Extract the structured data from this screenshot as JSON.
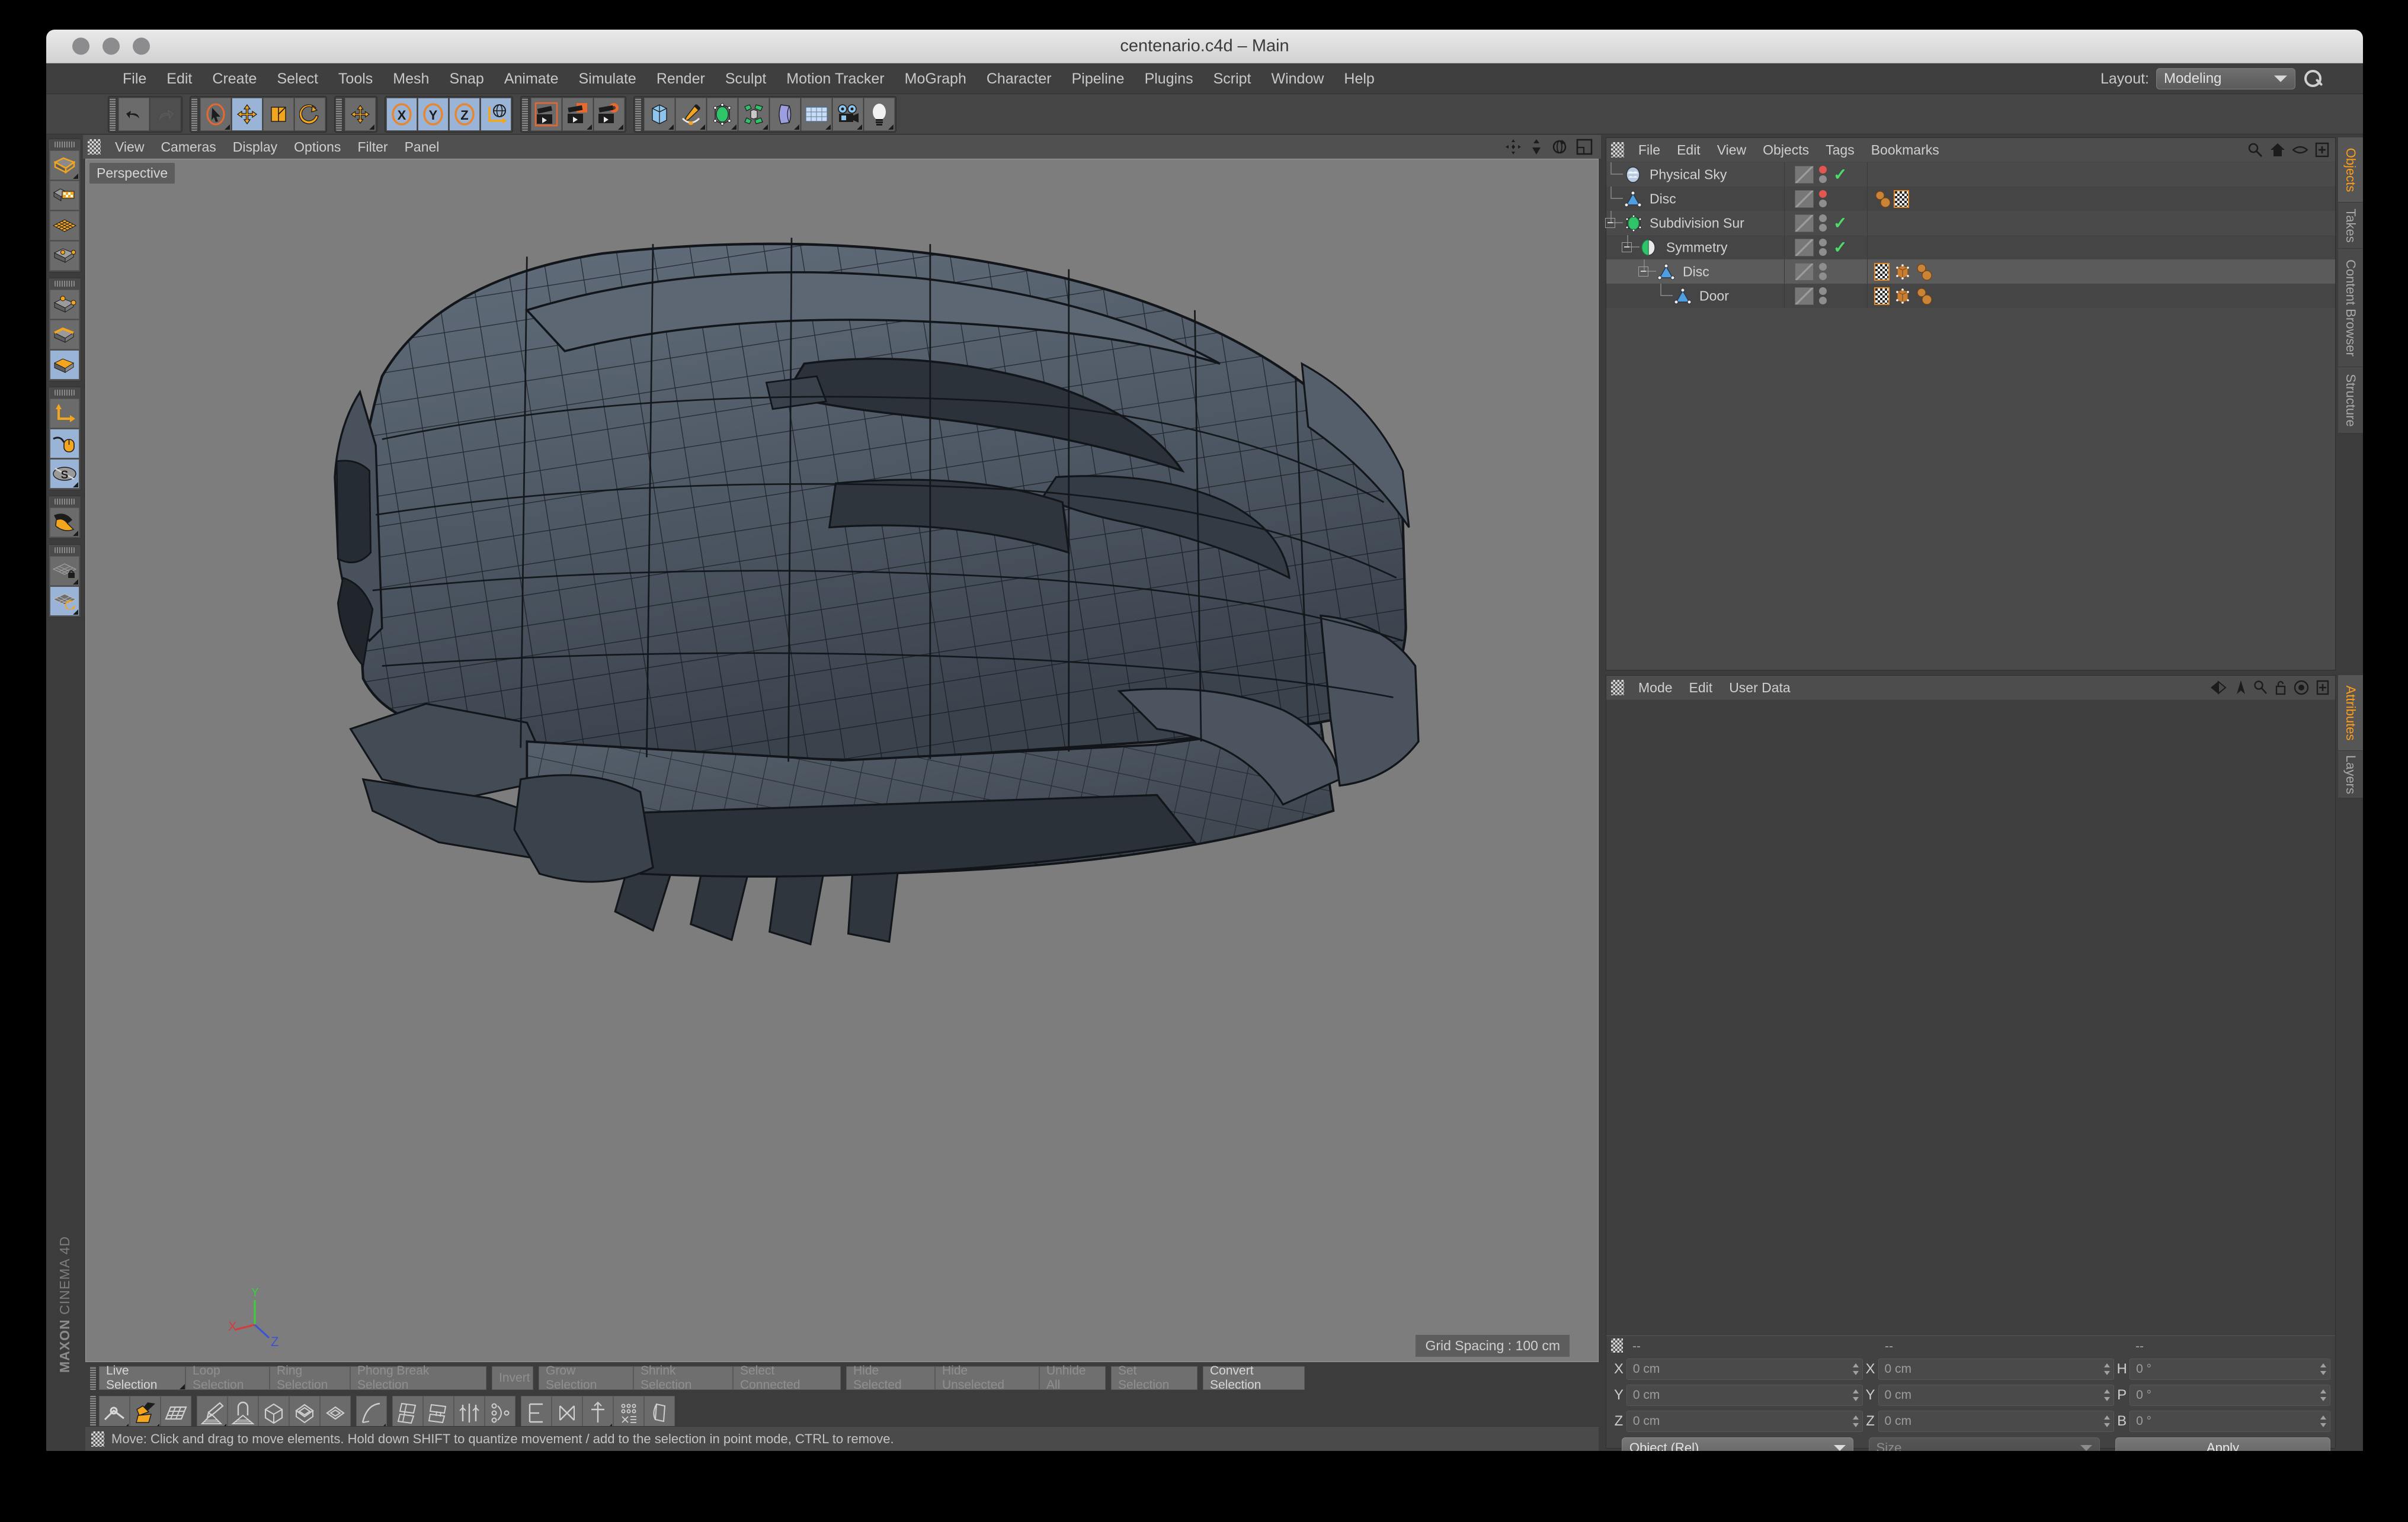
{
  "window": {
    "title": "centenario.c4d – Main",
    "traffic_lights": [
      "close",
      "minimize",
      "zoom"
    ]
  },
  "menubar": {
    "items": [
      "File",
      "Edit",
      "Create",
      "Select",
      "Tools",
      "Mesh",
      "Snap",
      "Animate",
      "Simulate",
      "Render",
      "Sculpt",
      "Motion Tracker",
      "MoGraph",
      "Character",
      "Pipeline",
      "Plugins",
      "Script",
      "Window",
      "Help"
    ],
    "layout_label": "Layout:",
    "layout_value": "Modeling",
    "search_icon": "search-icon"
  },
  "toolbar": {
    "groups": [
      {
        "name": "history",
        "buttons": [
          {
            "icon": "undo-icon",
            "state": "normal"
          },
          {
            "icon": "redo-icon",
            "state": "disabled"
          }
        ]
      },
      {
        "name": "tools",
        "buttons": [
          {
            "icon": "live-selection-icon",
            "state": "normal"
          },
          {
            "icon": "move-icon",
            "state": "active"
          },
          {
            "icon": "scale-icon",
            "state": "normal"
          },
          {
            "icon": "rotate-icon",
            "state": "normal"
          }
        ]
      },
      {
        "name": "axis",
        "buttons": [
          {
            "icon": "move-axis-icon",
            "state": "normal"
          }
        ]
      },
      {
        "name": "locks",
        "buttons": [
          {
            "icon": "x-lock-icon",
            "state": "active"
          },
          {
            "icon": "y-lock-icon",
            "state": "active"
          },
          {
            "icon": "z-lock-icon",
            "state": "active"
          },
          {
            "icon": "world-coord-icon",
            "state": "active"
          }
        ]
      },
      {
        "name": "render",
        "buttons": [
          {
            "icon": "render-view-icon",
            "state": "normal"
          },
          {
            "icon": "render-picture-viewer-icon",
            "state": "normal"
          },
          {
            "icon": "render-settings-icon",
            "state": "normal"
          }
        ]
      },
      {
        "name": "create",
        "buttons": [
          {
            "icon": "cube-primitive-icon",
            "state": "normal"
          },
          {
            "icon": "spline-pen-icon",
            "state": "normal"
          },
          {
            "icon": "generator-icon",
            "state": "normal"
          },
          {
            "icon": "array-deformer-icon",
            "state": "normal"
          },
          {
            "icon": "bend-deformer-icon",
            "state": "normal"
          },
          {
            "icon": "floor-environment-icon",
            "state": "normal"
          },
          {
            "icon": "camera-icon",
            "state": "normal"
          },
          {
            "icon": "light-icon",
            "state": "normal"
          }
        ]
      }
    ]
  },
  "left_toolbar": {
    "groups": [
      {
        "buttons": [
          {
            "icon": "make-editable-icon",
            "state": "normal"
          },
          {
            "icon": "model-mode-icon",
            "state": "normal"
          },
          {
            "icon": "texture-mode-icon",
            "state": "normal"
          },
          {
            "icon": "workplane-mode-icon",
            "state": "normal"
          }
        ]
      },
      {
        "buttons": [
          {
            "icon": "points-mode-icon",
            "state": "normal"
          },
          {
            "icon": "edges-mode-icon",
            "state": "normal"
          },
          {
            "icon": "polygons-mode-icon",
            "state": "active"
          }
        ]
      },
      {
        "buttons": [
          {
            "icon": "object-axis-icon",
            "state": "normal"
          },
          {
            "icon": "enable-axis-icon",
            "state": "active"
          },
          {
            "icon": "soft-selection-icon",
            "state": "active"
          }
        ]
      },
      {
        "buttons": [
          {
            "icon": "snap-magnet-icon",
            "state": "normal"
          }
        ]
      },
      {
        "buttons": [
          {
            "icon": "lock-workplane-icon",
            "state": "normal"
          },
          {
            "icon": "planar-workplane-icon",
            "state": "active"
          }
        ]
      }
    ]
  },
  "viewport": {
    "menus": [
      "View",
      "Cameras",
      "Display",
      "Options",
      "Filter",
      "Panel"
    ],
    "corner_icons": [
      "pan-icon",
      "zoom-icon",
      "rotate-icon",
      "maximize-icon"
    ],
    "label": "Perspective",
    "grid_spacing": "Grid Spacing : 100 cm",
    "axis_gizmo": {
      "x_label": "X",
      "y_label": "Y",
      "z_label": "Z",
      "x_color": "#d43b3b",
      "y_color": "#3fcc3f",
      "z_color": "#3b53d4"
    },
    "model": {
      "name": "centenario-car-wireframe",
      "fill": "#545e6b",
      "wire": "#111416"
    },
    "background": "#7d7d7d"
  },
  "brand": {
    "line1": "MAXON",
    "line2": "CINEMA 4D"
  },
  "bottom_bar": {
    "selection_buttons": [
      {
        "label": "Live Selection",
        "state": "normal"
      },
      {
        "label": "Loop Selection",
        "state": "dim"
      },
      {
        "label": "Ring Selection",
        "state": "dim"
      },
      {
        "label": "Phong Break Selection",
        "state": "dim"
      },
      {
        "label": "Invert",
        "state": "dim"
      },
      {
        "label": "Grow Selection",
        "state": "dim"
      },
      {
        "label": "Shrink Selection",
        "state": "dim"
      },
      {
        "label": "Select Connected",
        "state": "dim"
      },
      {
        "label": "Hide Selected",
        "state": "dim"
      },
      {
        "label": "Hide Unselected",
        "state": "dim"
      },
      {
        "label": "Unhide All",
        "state": "dim"
      },
      {
        "label": "Set Selection",
        "state": "dim"
      },
      {
        "label": "Convert Selection",
        "state": "normal"
      }
    ],
    "tool_icons": [
      "magnet-tool-icon",
      "knife-icon",
      "grid-polygon-icon",
      "brush-icon",
      "arch-icon",
      "extrude-icon",
      "extrude-inner-icon",
      "bevel-icon",
      "spline-tool-icon",
      "polygon-pen-icon",
      "bridge-icon",
      "mirror-icon",
      "weld-icon",
      "array-icon",
      "cut-icon",
      "axis-center-icon",
      "subdivide-icon",
      "optimize-icon"
    ],
    "status": "Move: Click and drag to move elements. Hold down SHIFT to quantize movement / add to the selection in point mode, CTRL to remove."
  },
  "object_manager": {
    "menus": [
      "File",
      "Edit",
      "View",
      "Objects",
      "Tags",
      "Bookmarks"
    ],
    "header_icons": [
      "search-icon",
      "home-icon",
      "eye-icon",
      "add-icon"
    ],
    "rows": [
      {
        "name": "Physical Sky",
        "depth": 0,
        "icon": "physical-sky-icon",
        "expander": "none",
        "dot_top": "red",
        "dot_bottom": "gray",
        "check": true,
        "tags": [],
        "selected": false
      },
      {
        "name": "Disc",
        "depth": 0,
        "icon": "disc-icon",
        "expander": "none",
        "dot_top": "red",
        "dot_bottom": "gray",
        "check": false,
        "tags": [
          "sun-expression-icon",
          "checker-texture-icon"
        ],
        "selected": false
      },
      {
        "name": "Subdivision Sur",
        "depth": 0,
        "icon": "subdivision-surface-icon",
        "expander": "minus",
        "dot_top": "gray",
        "dot_bottom": "gray",
        "check": true,
        "tags": [],
        "selected": false
      },
      {
        "name": "Symmetry",
        "depth": 1,
        "icon": "symmetry-icon",
        "expander": "minus",
        "dot_top": "gray",
        "dot_bottom": "gray",
        "check": true,
        "tags": [],
        "selected": false
      },
      {
        "name": "Disc",
        "depth": 2,
        "icon": "disc-icon",
        "expander": "minus",
        "dot_top": "gray",
        "dot_bottom": "gray",
        "check": false,
        "tags": [
          "checker-texture-icon",
          "phong-tag-icon",
          "sun-expression-icon"
        ],
        "selected": true
      },
      {
        "name": "Door",
        "depth": 3,
        "icon": "disc-icon",
        "expander": "none",
        "dot_top": "gray",
        "dot_bottom": "gray",
        "check": false,
        "tags": [
          "checker-texture-icon",
          "phong-tag-icon",
          "sun-expression-icon"
        ],
        "selected": false
      }
    ]
  },
  "attribute_manager": {
    "menus": [
      "Mode",
      "Edit",
      "User Data"
    ],
    "header_icons": [
      "back-forward-icon",
      "pin-icon",
      "search-icon",
      "lock-icon",
      "target-icon",
      "add-icon"
    ],
    "content": ""
  },
  "coordinates": {
    "col_headers": [
      "--",
      "--",
      "--"
    ],
    "position": {
      "label_x": "X",
      "x": "0 cm",
      "label_y": "Y",
      "y": "0 cm",
      "label_z": "Z",
      "z": "0 cm"
    },
    "size": {
      "label_x": "X",
      "x": "0 cm",
      "label_y": "Y",
      "y": "0 cm",
      "label_z": "Z",
      "z": "0 cm"
    },
    "rotation": {
      "label_h": "H",
      "h": "0 °",
      "label_p": "P",
      "p": "0 °",
      "label_b": "B",
      "b": "0 °"
    },
    "mode_dropdown": "Object (Rel)",
    "size_dropdown": "Size",
    "apply_button": "Apply"
  },
  "right_tabs": {
    "top": [
      {
        "label": "Objects",
        "active": true
      },
      {
        "label": "Takes",
        "active": false
      },
      {
        "label": "Content Browser",
        "active": false
      },
      {
        "label": "Structure",
        "active": false
      }
    ],
    "bottom": [
      {
        "label": "Attributes",
        "active": true
      },
      {
        "label": "Layers",
        "active": false
      }
    ]
  },
  "colors": {
    "accent_orange": "#ff9c1a",
    "panel_bg": "#3c3c3c",
    "button_bg": "#6b6b6b",
    "active_blue": "#9ab4d8",
    "check_green": "#4ddc6a",
    "dot_red": "#e2564f",
    "viewport_bg": "#7d7d7d"
  }
}
